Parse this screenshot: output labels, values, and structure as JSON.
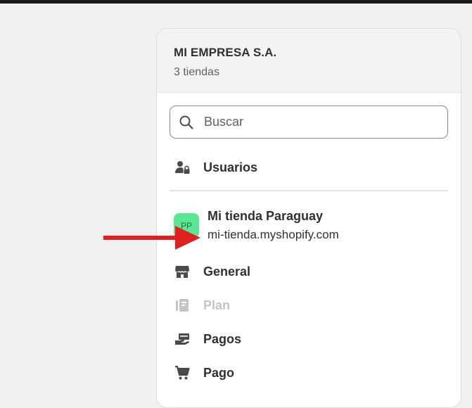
{
  "organization": {
    "name": "MI EMPRESA S.A.",
    "store_count": "3 tiendas"
  },
  "search": {
    "placeholder": "Buscar"
  },
  "users_item": {
    "label": "Usuarios",
    "icon": "users-lock-icon"
  },
  "store": {
    "initials": "PP",
    "name": "Mi tienda Paraguay",
    "url": "mi-tienda.myshopify.com",
    "avatar_color": "#5ce694"
  },
  "menu": [
    {
      "label": "General",
      "icon": "store-icon",
      "disabled": false
    },
    {
      "label": "Plan",
      "icon": "plan-icon",
      "disabled": true
    },
    {
      "label": "Pagos",
      "icon": "payments-icon",
      "disabled": false
    },
    {
      "label": "Pago",
      "icon": "cart-icon",
      "disabled": false
    }
  ],
  "annotation": {
    "arrow_color": "#e02020"
  }
}
